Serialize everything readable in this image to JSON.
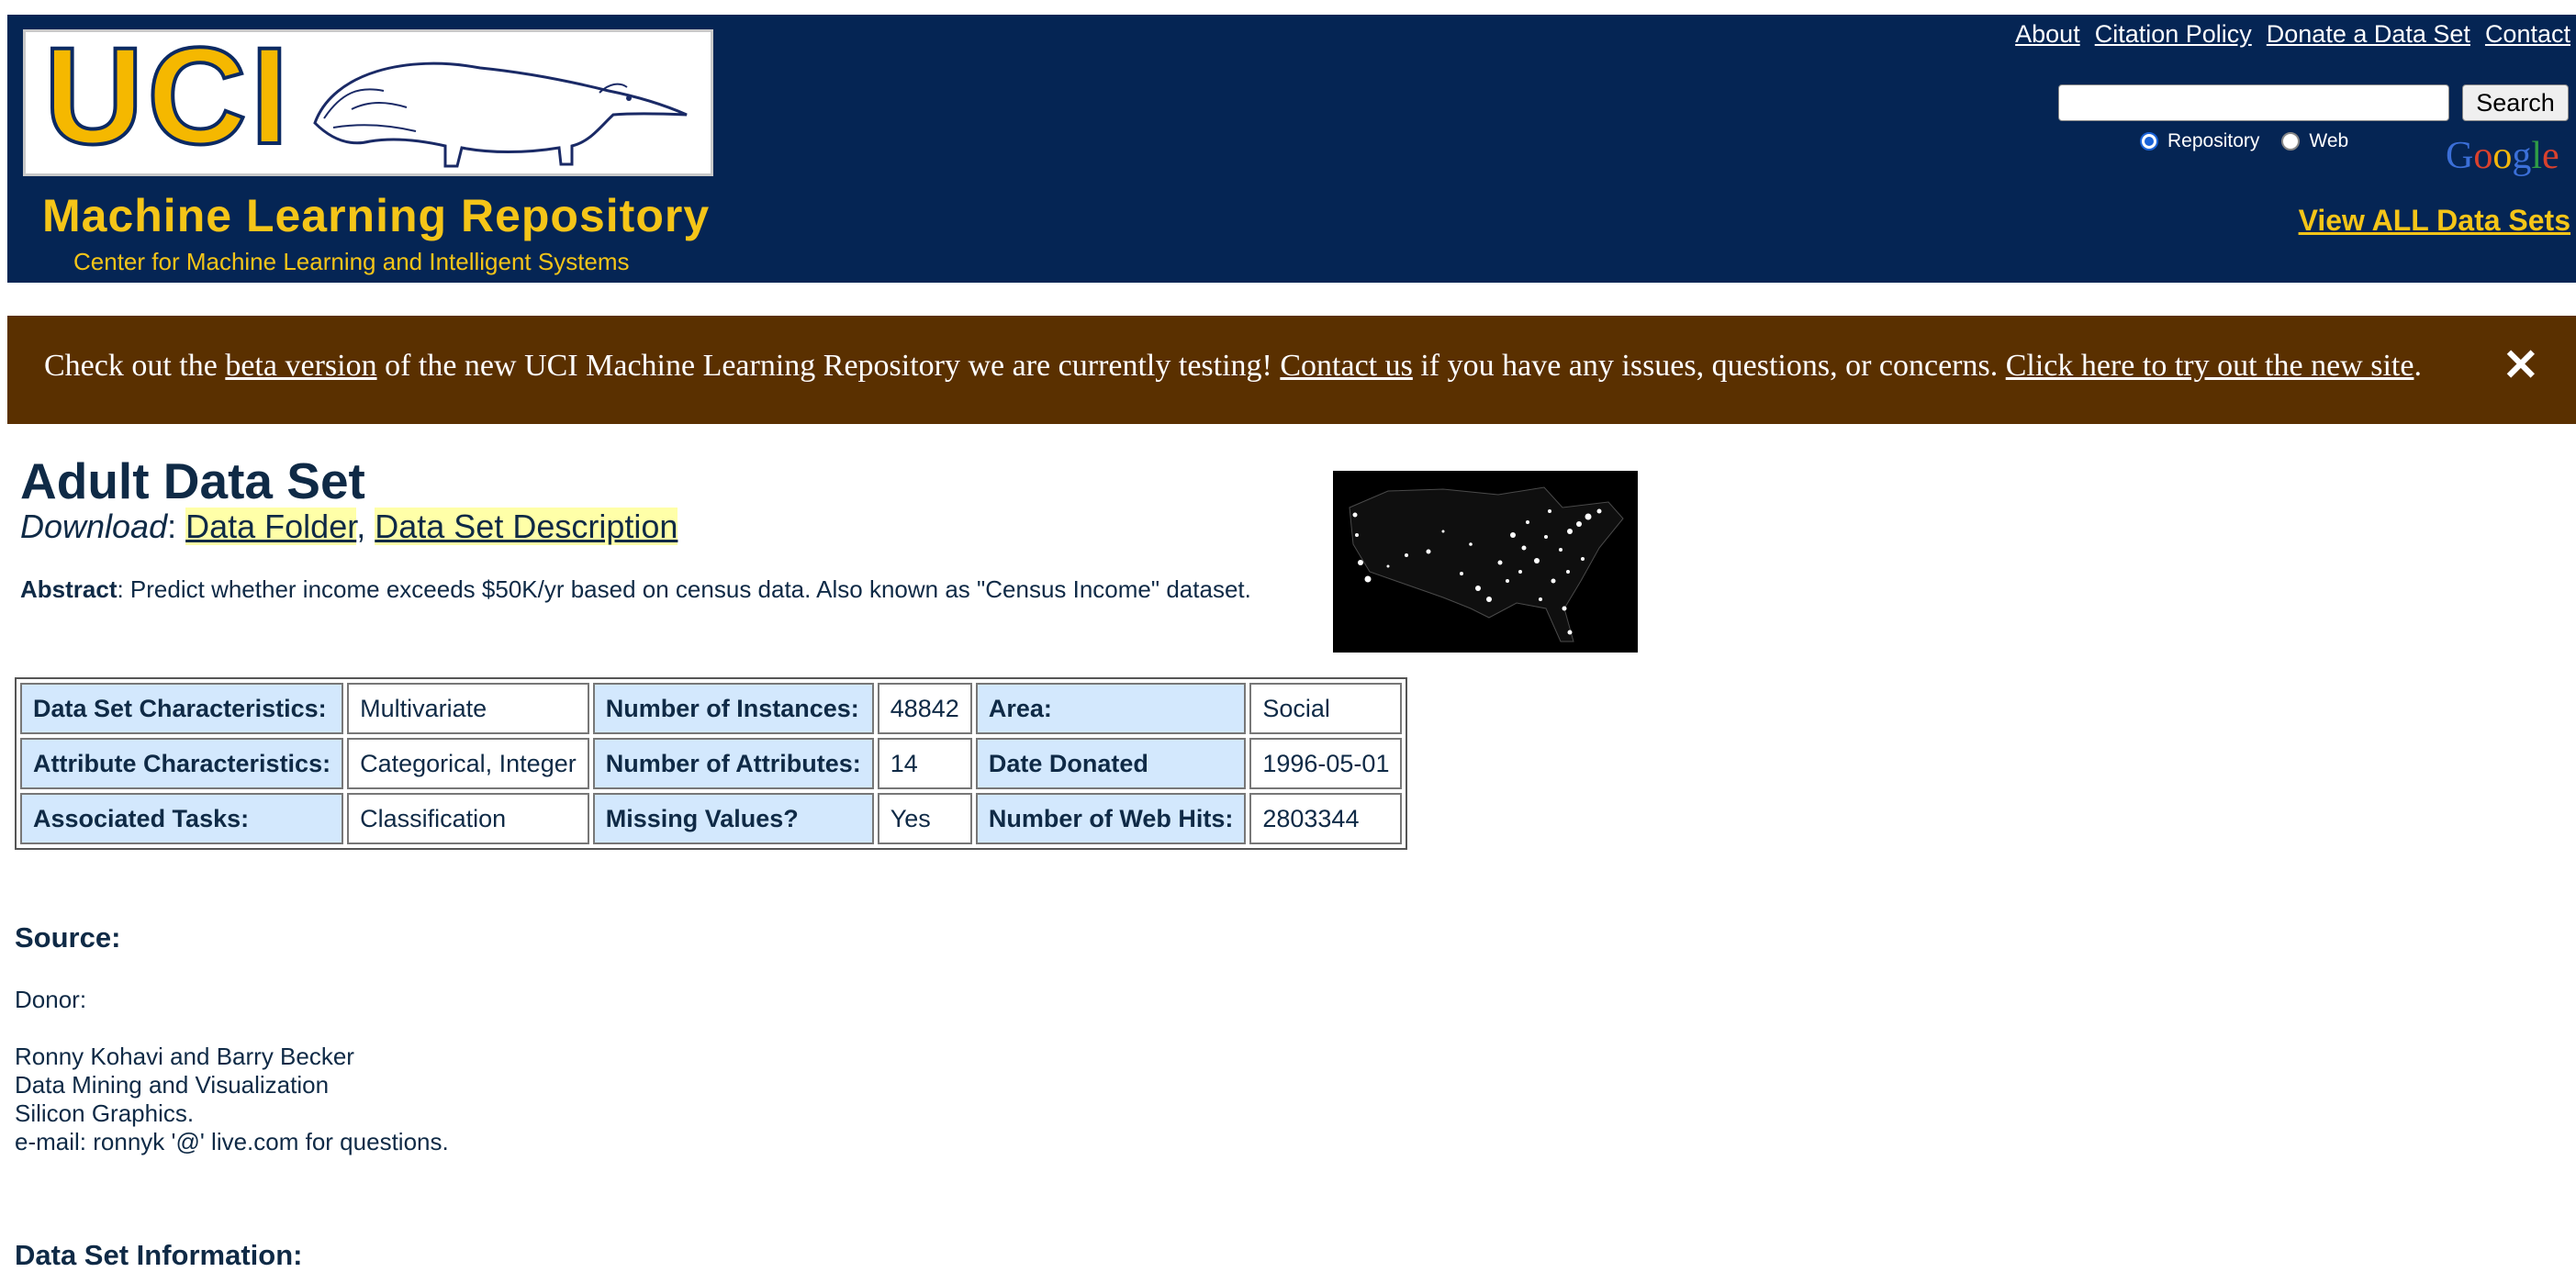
{
  "header": {
    "logo_text": "UCI",
    "repo_title": "Machine Learning Repository",
    "repo_subtitle": "Center for Machine Learning and Intelligent Systems",
    "links": [
      "About",
      "Citation Policy",
      "Donate a Data Set",
      "Contact"
    ],
    "search": {
      "value": "",
      "button": "Search"
    },
    "radio": {
      "repository": "Repository",
      "web": "Web",
      "selected": "Repository"
    },
    "google_logo": "Google",
    "view_all": "View ALL Data Sets"
  },
  "banner": {
    "text_1": "Check out the ",
    "link_1": "beta version",
    "text_2": " of the new UCI Machine Learning Repository we are currently testing! ",
    "link_2": "Contact us",
    "text_3": " if you have any issues, questions, or concerns. ",
    "link_3": "Click here to try out the new site",
    "text_4": ".",
    "close": "✕"
  },
  "dataset": {
    "title": "Adult Data Set",
    "download_label": "Download",
    "download_links": [
      "Data Folder",
      "Data Set Description"
    ],
    "abstract_label": "Abstract",
    "abstract_text": ": Predict whether income exceeds $50K/yr based on census data. Also known as \"Census Income\" dataset."
  },
  "table": [
    [
      {
        "k": "Data Set Characteristics:"
      },
      {
        "v": "Multivariate"
      },
      {
        "k": "Number of Instances:"
      },
      {
        "v": "48842"
      },
      {
        "k": "Area:"
      },
      {
        "v": "Social"
      }
    ],
    [
      {
        "k": "Attribute Characteristics:"
      },
      {
        "v": "Categorical, Integer"
      },
      {
        "k": "Number of Attributes:"
      },
      {
        "v": "14"
      },
      {
        "k": "Date Donated"
      },
      {
        "v": "1996-05-01"
      }
    ],
    [
      {
        "k": "Associated Tasks:"
      },
      {
        "v": "Classification"
      },
      {
        "k": "Missing Values?"
      },
      {
        "v": "Yes"
      },
      {
        "k": "Number of Web Hits:"
      },
      {
        "v": "2803344"
      }
    ]
  ],
  "source": {
    "title": "Source:",
    "donor_label": "Donor:",
    "donor_lines": [
      "Ronny Kohavi and Barry Becker",
      "Data Mining and Visualization",
      "Silicon Graphics.",
      "e-mail: ronnyk '@' live.com for questions."
    ]
  },
  "next_section": "Data Set Information:"
}
